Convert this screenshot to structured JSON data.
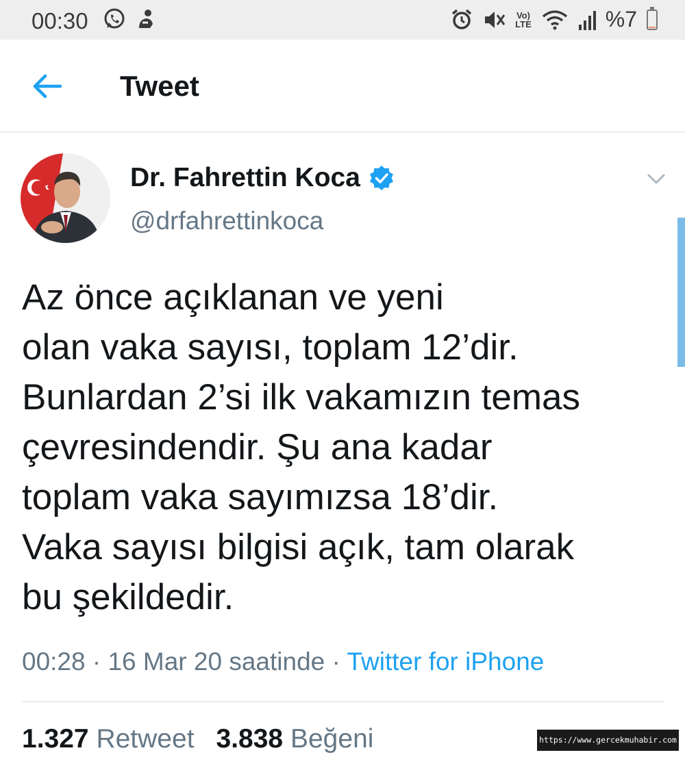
{
  "status_bar": {
    "time": "00:30",
    "left_icons": [
      "whatsapp-icon",
      "notification-icon"
    ],
    "right_icons": [
      "alarm-icon",
      "vibrate-icon",
      "volte-icon",
      "wifi-icon",
      "signal-icon"
    ],
    "volte_label_top": "Vo)",
    "volte_label_bottom": "LTE",
    "battery": "%7",
    "battery_level": 0.07
  },
  "header": {
    "back_icon": "back-arrow-icon",
    "title": "Tweet"
  },
  "tweet": {
    "author_name": "Dr. Fahrettin Koca",
    "author_handle": "@drfahrettinkoca",
    "verified": true,
    "text": "Az önce açıklanan ve yeni\nolan vaka sayısı, toplam 12’dir.\nBunlardan 2’si ilk vakamızın temas\nçevresindendir. Şu ana kadar\ntoplam vaka sayımızsa 18’dir.\nVaka sayısı bilgisi açık, tam olarak\nbu şekildedir.",
    "timestamp": "00:28 · 16 Mar 20 saatinde · ",
    "source": "Twitter for iPhone",
    "retweet_count": "1.327",
    "retweet_label": "Retweet",
    "like_count": "3.838",
    "like_label": "Beğeni"
  },
  "colors": {
    "accent": "#1da1f2",
    "secondary_text": "#657786",
    "primary_text": "#14171a"
  },
  "watermark": "https://www.gercekmuhabir.com"
}
